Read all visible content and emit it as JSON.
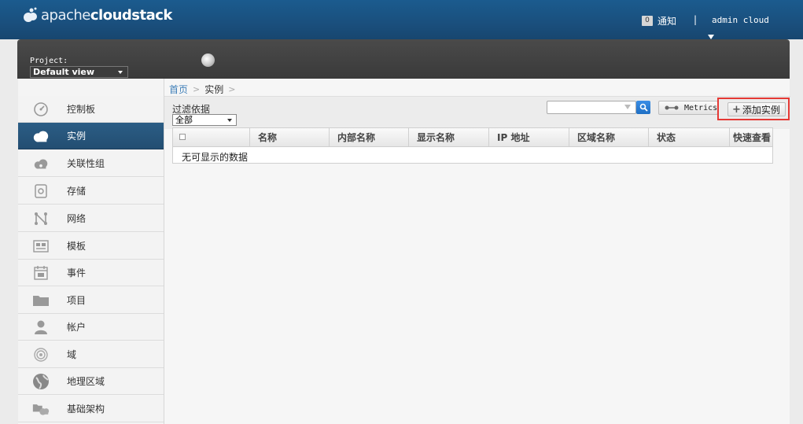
{
  "header": {
    "logo_light": "apache",
    "logo_bold": "cloudstack",
    "notifications_count": "0",
    "notifications_label": "通知",
    "separator": "|",
    "user": "admin cloud"
  },
  "project": {
    "label": "Project:",
    "selected": "Default view"
  },
  "sidebar": {
    "items": [
      {
        "label": "控制板",
        "icon": "dashboard-icon"
      },
      {
        "label": "实例",
        "icon": "cloud-icon",
        "active": true
      },
      {
        "label": "关联性组",
        "icon": "affinity-icon"
      },
      {
        "label": "存储",
        "icon": "storage-icon"
      },
      {
        "label": "网络",
        "icon": "network-icon"
      },
      {
        "label": "模板",
        "icon": "template-icon"
      },
      {
        "label": "事件",
        "icon": "calendar-icon"
      },
      {
        "label": "项目",
        "icon": "folder-icon"
      },
      {
        "label": "帐户",
        "icon": "user-icon"
      },
      {
        "label": "域",
        "icon": "domain-icon"
      },
      {
        "label": "地理区域",
        "icon": "globe-icon"
      },
      {
        "label": "基础架构",
        "icon": "infrastructure-icon"
      }
    ]
  },
  "breadcrumb": {
    "home": "首页",
    "current": "实例"
  },
  "toolbar": {
    "filter_label": "过滤依据",
    "filter_selected": "全部",
    "search_placeholder": "",
    "metrics_label": "Metrics",
    "add_label": "添加实例"
  },
  "table": {
    "columns": [
      "名称",
      "内部名称",
      "显示名称",
      "IP 地址",
      "区域名称",
      "状态",
      "快速查看"
    ],
    "empty_message": "无可显示的数据"
  },
  "colors": {
    "header_blue": "#1a4f7d",
    "active_nav": "#2b5d85",
    "link_blue": "#3f7fb8",
    "highlight_red": "#e53935"
  }
}
